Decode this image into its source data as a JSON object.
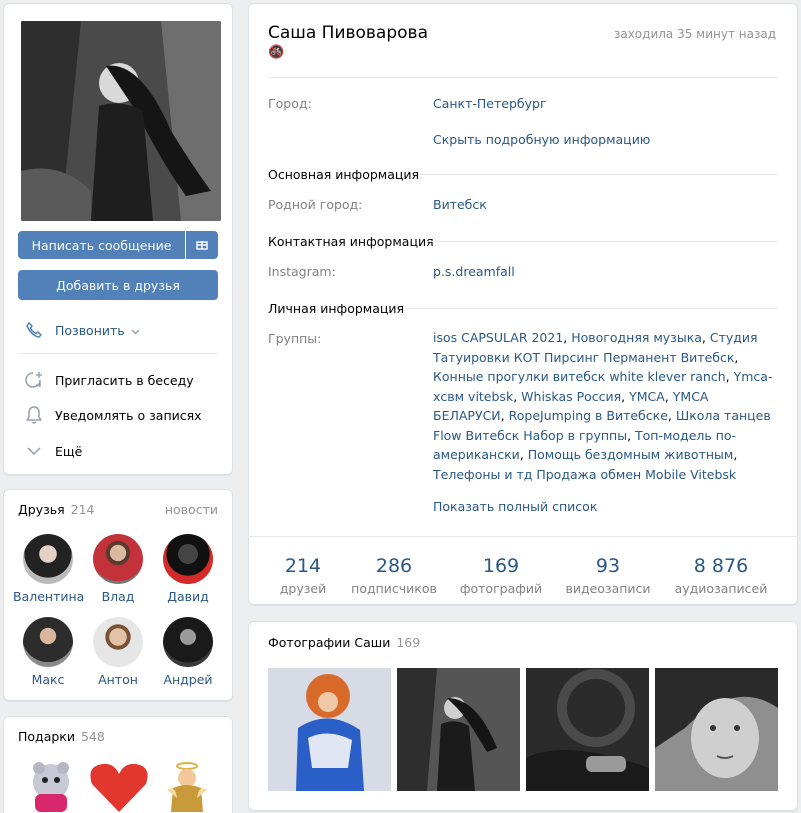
{
  "profile": {
    "name": "Саша Пивоварова",
    "status_emoji": "🚳",
    "online": "заходила 35 минут назад"
  },
  "actions": {
    "message": "Написать сообщение",
    "add_friend": "Добавить в друзья",
    "call": "Позвонить",
    "invite": "Пригласить в беседу",
    "notify": "Уведомлять о записях",
    "more": "Ещё"
  },
  "info": {
    "city_label": "Город:",
    "city": "Санкт-Петербург",
    "hide_details": "Скрыть подробную информацию",
    "basic_header": "Основная информация",
    "hometown_label": "Родной город:",
    "hometown": "Витебск",
    "contact_header": "Контактная информация",
    "instagram_label": "Instagram:",
    "instagram": "p.s.dreamfall",
    "personal_header": "Личная информация",
    "groups_label": "Группы:",
    "groups": [
      "isos CAPSULAR 2021",
      "Новогодняя музыка",
      "Студия Татуировки КОТ Пирсинг Перманент Витебск",
      "Конные прогулки витебск white klever ranch",
      "Ymca-хсвм vitebsk",
      "Whiskas Россия",
      "YMCA",
      "YMCA БЕЛАРУСИ",
      "RopeJumping в Витебске",
      "Школа танцев Flow Витебск Набор в группы",
      "Топ-модель по-американски",
      "Помощь бездомным животным",
      "Телефоны и тд Продажа обмен Mobile Vitebsk"
    ],
    "show_all": "Показать полный список"
  },
  "counters": [
    {
      "value": "214",
      "label": "друзей"
    },
    {
      "value": "286",
      "label": "подписчиков"
    },
    {
      "value": "169",
      "label": "фотографий"
    },
    {
      "value": "93",
      "label": "видеозаписи"
    },
    {
      "value": "8 876",
      "label": "аудиозаписей"
    }
  ],
  "friends": {
    "title": "Друзья",
    "count": "214",
    "news": "новости",
    "items": [
      {
        "name": "Валентина"
      },
      {
        "name": "Влад"
      },
      {
        "name": "Давид"
      },
      {
        "name": "Макс"
      },
      {
        "name": "Антон"
      },
      {
        "name": "Андрей"
      }
    ]
  },
  "gifts": {
    "title": "Подарки",
    "count": "548"
  },
  "photos": {
    "title": "Фотографии Саши",
    "count": "169"
  },
  "colors": {
    "accent": "#5181b8",
    "link": "#2a5885",
    "background": "#edeef0"
  }
}
